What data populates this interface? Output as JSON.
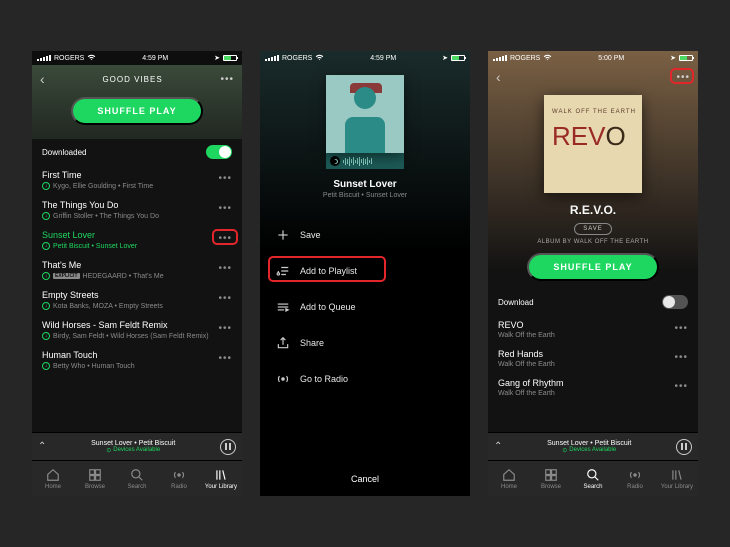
{
  "screen1": {
    "status": {
      "carrier": "ROGERS",
      "time": "4:59 PM"
    },
    "playlist_title": "GOOD VIBES",
    "shuffle_label": "SHUFFLE PLAY",
    "downloaded_label": "Downloaded",
    "tracks": [
      {
        "title": "First Time",
        "sub": "Kygo, Ellie Goulding • First Time",
        "dl": true
      },
      {
        "title": "The Things You Do",
        "sub": "Griffin Stoller • The Things You Do",
        "dl": true
      },
      {
        "title": "Sunset Lover",
        "sub": "Petit Biscuit • Sunset Lover",
        "dl": true,
        "playing": true,
        "highlight": true
      },
      {
        "title": "That's Me",
        "sub": "HEDEGAARD • That's Me",
        "dl": true,
        "explicit": true
      },
      {
        "title": "Empty Streets",
        "sub": "Kota Banks, MOZA • Empty Streets",
        "dl": true
      },
      {
        "title": "Wild Horses - Sam Feldt Remix",
        "sub": "Birdy, Sam Feldt • Wild Horses (Sam Feldt Remix)",
        "dl": true
      },
      {
        "title": "Human Touch",
        "sub": "Betty Who • Human Touch",
        "dl": true
      }
    ],
    "now_playing": {
      "song": "Sunset Lover",
      "artist": "Petit Biscuit",
      "devices": "Devices Available"
    },
    "tabs": [
      "Home",
      "Browse",
      "Search",
      "Radio",
      "Your Library"
    ],
    "active_tab": 4
  },
  "screen2": {
    "status": {
      "carrier": "ROGERS",
      "time": "4:59 PM"
    },
    "song": "Sunset Lover",
    "artist": "Petit Biscuit • Sunset Lover",
    "menu": [
      {
        "label": "Save",
        "icon": "plus"
      },
      {
        "label": "Add to Playlist",
        "icon": "add-playlist",
        "highlight": true
      },
      {
        "label": "Add to Queue",
        "icon": "queue"
      },
      {
        "label": "Share",
        "icon": "share"
      },
      {
        "label": "Go to Radio",
        "icon": "radio"
      }
    ],
    "cancel": "Cancel"
  },
  "screen3": {
    "status": {
      "carrier": "ROGERS",
      "time": "5:00 PM"
    },
    "album_super": "WALK OFF THE EARTH",
    "album_title": "R.E.V.O.",
    "save_label": "SAVE",
    "album_sub": "ALBUM BY WALK OFF THE EARTH",
    "shuffle_label": "SHUFFLE PLAY",
    "download_label": "Download",
    "tracks": [
      {
        "title": "REVO",
        "sub": "Walk Off the Earth"
      },
      {
        "title": "Red Hands",
        "sub": "Walk Off the Earth"
      },
      {
        "title": "Gang of Rhythm",
        "sub": "Walk Off the Earth"
      }
    ],
    "now_playing": {
      "song": "Sunset Lover",
      "artist": "Petit Biscuit",
      "devices": "Devices Available"
    },
    "tabs": [
      "Home",
      "Browse",
      "Search",
      "Radio",
      "Your Library"
    ],
    "active_tab": 2
  }
}
